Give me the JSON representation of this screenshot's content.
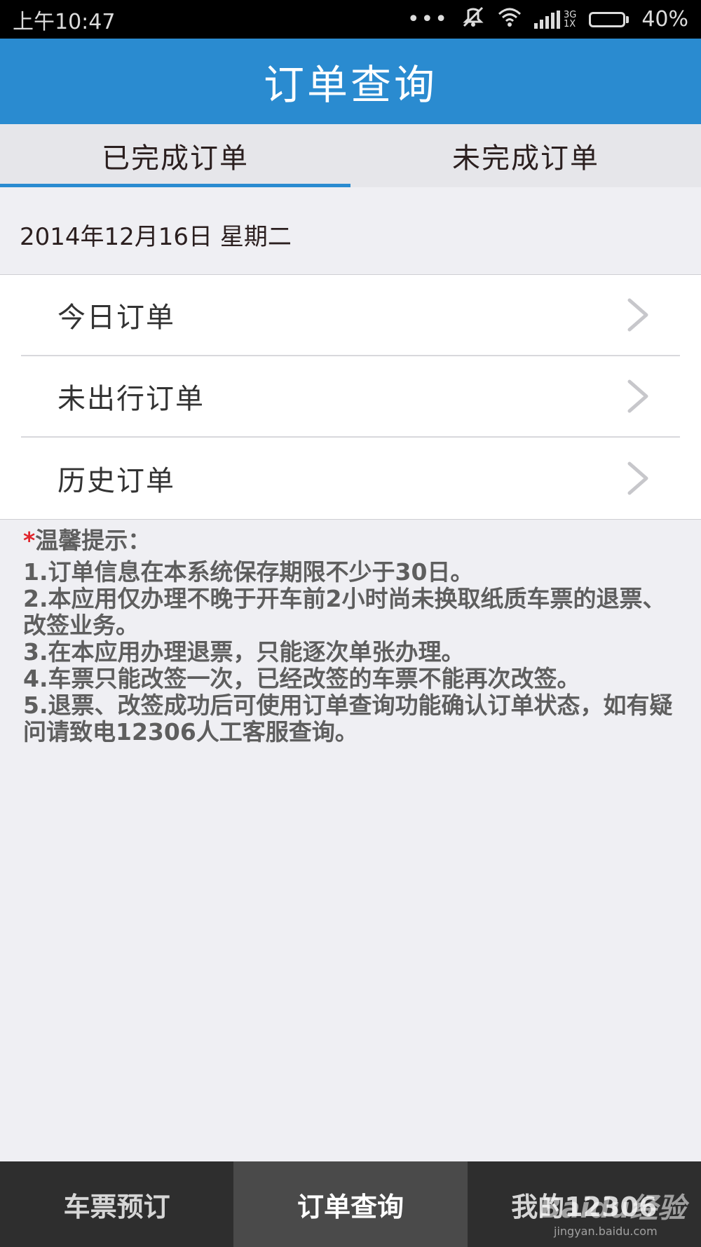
{
  "status_bar": {
    "time": "上午10:47",
    "signal_dots": "•••",
    "network_type_top": "3G",
    "network_type_bottom": "1X",
    "battery": "40%",
    "battery_level": 0.4,
    "icons": [
      "mute-icon",
      "wifi-icon",
      "signal-icon",
      "battery-icon"
    ]
  },
  "header": {
    "title": "订单查询"
  },
  "tabs": [
    {
      "label": "已完成订单",
      "active": true
    },
    {
      "label": "未完成订单",
      "active": false
    }
  ],
  "date_label": "2014年12月16日 星期二",
  "menu": [
    {
      "label": "今日订单",
      "icon": "chevron-right-icon"
    },
    {
      "label": "未出行订单",
      "icon": "chevron-right-icon"
    },
    {
      "label": "历史订单",
      "icon": "chevron-right-icon"
    }
  ],
  "tips": {
    "star": "*",
    "title": "温馨提示：",
    "lines": [
      "1.订单信息在本系统保存期限不少于30日。",
      "2.本应用仅办理不晚于开车前2小时尚未换取纸质车票的退票、改签业务。",
      "3.在本应用办理退票，只能逐次单张办理。",
      "4.车票只能改签一次，已经改签的车票不能再次改签。",
      "5.退票、改签成功后可使用订单查询功能确认订单状态，如有疑问请致电12306人工客服查询。"
    ]
  },
  "bottom_nav": [
    {
      "label": "车票预订",
      "active": false
    },
    {
      "label": "订单查询",
      "active": true
    },
    {
      "label": "我的12306",
      "active": false
    }
  ],
  "watermark": {
    "main": "Baidu经验",
    "sub": "jingyan.baidu.com"
  },
  "colors": {
    "accent": "#2a8bd0",
    "tab_bg": "#e6e6ea",
    "page_bg": "#efeff3",
    "nav_bg": "#2e2e2e",
    "nav_active_bg": "#4a4a4a",
    "star": "#e0252c"
  }
}
